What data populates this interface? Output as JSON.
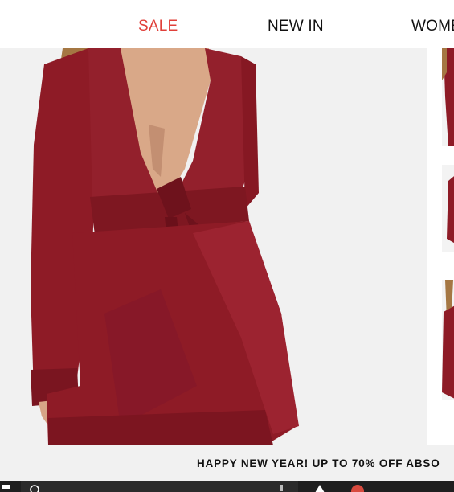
{
  "nav": {
    "items": [
      {
        "label": "SALE",
        "color": "#e0403a"
      },
      {
        "label": "NEW IN",
        "color": "#111111"
      },
      {
        "label": "WOME",
        "color": "#111111"
      }
    ]
  },
  "product_gallery": {
    "dress_color": "#8a1a24",
    "background": "#f1f1f1"
  },
  "promo": {
    "text": "HAPPY NEW YEAR! UP TO 70% OFF ABSO"
  },
  "taskbar": {
    "icons": [
      "windows-start-icon",
      "search-icon",
      "edge-icon",
      "chrome-icon"
    ]
  }
}
